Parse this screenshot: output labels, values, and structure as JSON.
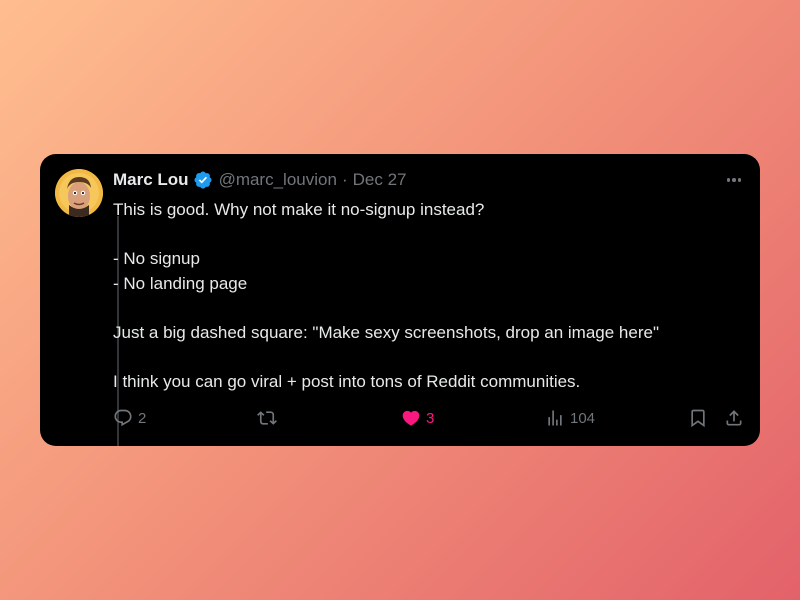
{
  "tweet": {
    "author": {
      "name": "Marc Lou",
      "handle": "@marc_louvion",
      "verified": true,
      "avatar": "avatar-photo"
    },
    "separator": "·",
    "date": "Dec 27",
    "more_icon": "more-dots-icon",
    "body": {
      "line1": "This is good. Why not make it no-signup instead?",
      "line2": "- No signup",
      "line3": "- No landing page",
      "line4": "Just a big dashed square: \"Make sexy screenshots, drop an image here\"",
      "line5": "I think you can go viral + post into tons of Reddit communities."
    },
    "actions": {
      "reply": {
        "icon": "reply-icon",
        "count": "2"
      },
      "retweet": {
        "icon": "retweet-icon",
        "count": ""
      },
      "like": {
        "icon": "heart-icon",
        "count": "3",
        "liked": true
      },
      "views": {
        "icon": "views-chart-icon",
        "count": "104"
      },
      "bookmark": {
        "icon": "bookmark-icon"
      },
      "share": {
        "icon": "share-icon"
      }
    }
  },
  "colors": {
    "card_background": "#000000",
    "primary_text": "#e7e9ea",
    "secondary_text": "#71767b",
    "like_color": "#f91880",
    "verified_blue": "#1d9bf0",
    "background_gradient_start": "#ffbe8f",
    "background_gradient_end": "#e3626a"
  }
}
